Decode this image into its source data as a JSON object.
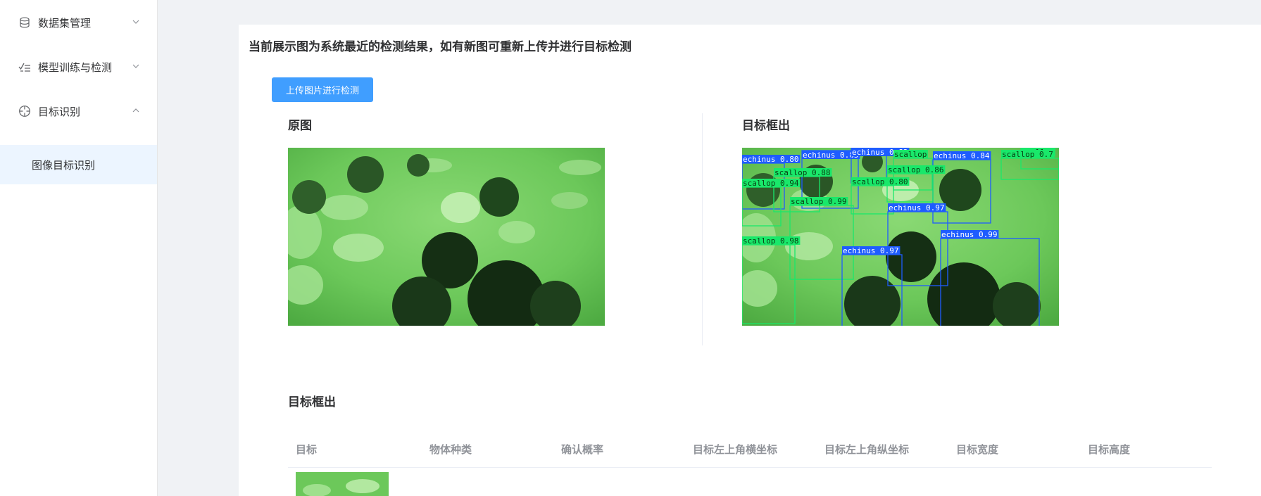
{
  "sidebar": {
    "items": [
      {
        "label": "数据集管理",
        "icon": "database-icon",
        "expanded": false
      },
      {
        "label": "模型训练与检测",
        "icon": "checklist-icon",
        "expanded": false
      },
      {
        "label": "目标识别",
        "icon": "target-icon",
        "expanded": true
      }
    ],
    "subitem_label": "图像目标识别"
  },
  "main": {
    "notice": "当前展示图为系统最近的检测结果，如有新图可重新上传并进行目标检测",
    "upload_label": "上传图片进行检测",
    "original_title": "原图",
    "detected_title": "目标框出",
    "table_title": "目标框出"
  },
  "detections": [
    {
      "label": "echinus 0.80",
      "cls": "echinus"
    },
    {
      "label": "echinus 0.85",
      "cls": "echinus"
    },
    {
      "label": "echinus 0.83",
      "cls": "echinus"
    },
    {
      "label": "scallop",
      "cls": "scallop"
    },
    {
      "label": "echinus 0.84",
      "cls": "echinus"
    },
    {
      "label": "scallop",
      "cls": "scallop"
    },
    {
      "label": "scallop 0.7",
      "cls": "scallop"
    },
    {
      "label": "scallop 0.88",
      "cls": "scallop"
    },
    {
      "label": "scallop 0.86",
      "cls": "scallop"
    },
    {
      "label": "scallop 0.94",
      "cls": "scallop"
    },
    {
      "label": "scallop 0.80",
      "cls": "scallop"
    },
    {
      "label": "scallop 0.99",
      "cls": "scallop"
    },
    {
      "label": "echinus 0.97",
      "cls": "echinus"
    },
    {
      "label": "echinus 0.99",
      "cls": "echinus"
    },
    {
      "label": "scallop 0.98",
      "cls": "scallop"
    },
    {
      "label": "echinus 0.97",
      "cls": "echinus"
    }
  ],
  "table": {
    "headers": [
      "目标",
      "物体种类",
      "确认概率",
      "目标左上角横坐标",
      "目标左上角纵坐标",
      "目标宽度",
      "目标高度"
    ]
  },
  "colors": {
    "accent": "#409eff",
    "echinus": "#1e5cff",
    "scallop": "#19e86a"
  }
}
